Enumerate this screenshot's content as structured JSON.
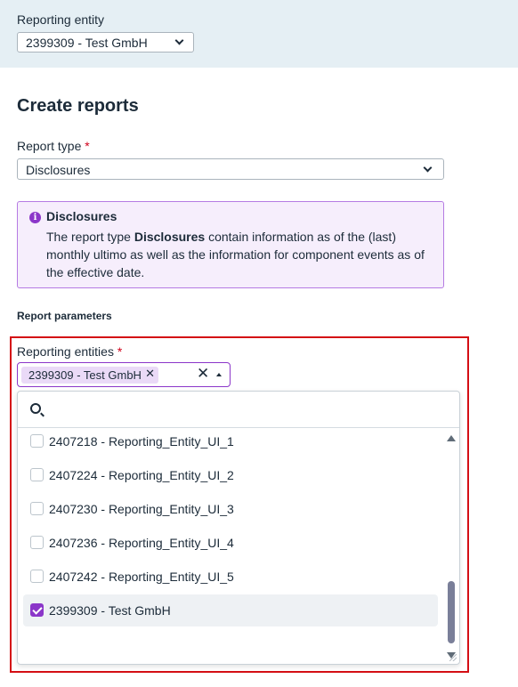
{
  "header": {
    "reporting_entity_label": "Reporting entity",
    "reporting_entity_value": "2399309 - Test GmbH"
  },
  "page": {
    "title": "Create reports"
  },
  "report_type": {
    "label": "Report type",
    "required_mark": "*",
    "value": "Disclosures"
  },
  "info": {
    "icon": "info-icon",
    "title": "Disclosures",
    "text_before": "The report type ",
    "text_bold": "Disclosures",
    "text_after": " contain information as of the (last) monthly ultimo as well as the information for component events as of the effective date."
  },
  "report_parameters": {
    "heading": "Report parameters",
    "reporting_entities": {
      "label": "Reporting entities",
      "required_mark": "*",
      "chips": [
        {
          "label": "2399309 - Test GmbH"
        }
      ],
      "search_placeholder": "",
      "options": [
        {
          "label": "2407218 - Reporting_Entity_UI_1",
          "checked": false
        },
        {
          "label": "2407224 - Reporting_Entity_UI_2",
          "checked": false
        },
        {
          "label": "2407230 - Reporting_Entity_UI_3",
          "checked": false
        },
        {
          "label": "2407236 - Reporting_Entity_UI_4",
          "checked": false
        },
        {
          "label": "2407242 - Reporting_Entity_UI_5",
          "checked": false
        },
        {
          "label": "2399309 - Test GmbH",
          "checked": true
        }
      ]
    }
  },
  "colors": {
    "accent": "#8b36c9",
    "highlight_frame": "#d40e14",
    "header_band": "#e5eff4",
    "info_background": "#f6eefc"
  }
}
